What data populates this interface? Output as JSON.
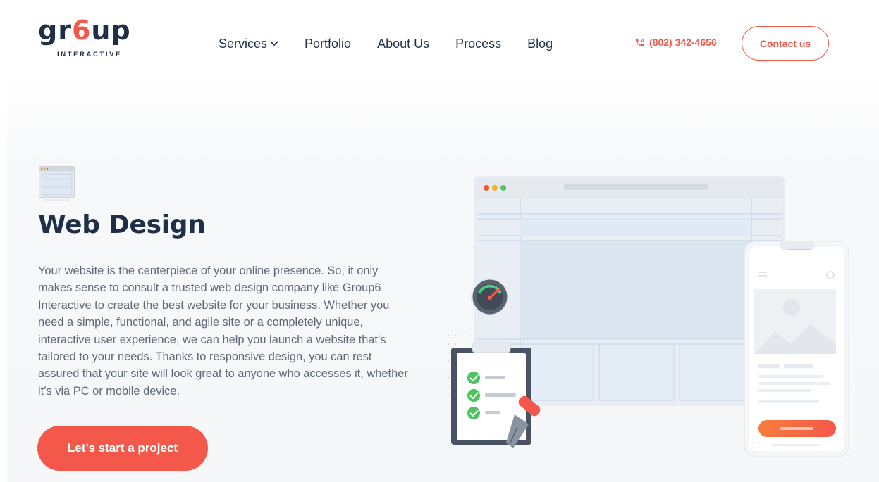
{
  "logo": {
    "word_part1": "gr",
    "word_six": "6",
    "word_part2": "up",
    "subtitle": "INTERACTIVE"
  },
  "nav": {
    "items": [
      {
        "label": "Services"
      },
      {
        "label": "Portfolio"
      },
      {
        "label": "About Us"
      },
      {
        "label": "Process"
      },
      {
        "label": "Blog"
      }
    ]
  },
  "header": {
    "phone": "(802) 342-4656",
    "contact_label": "Contact us"
  },
  "hero": {
    "title": "Web Design",
    "description": "Your website is the centerpiece of your online presence. So, it only makes sense to consult a trusted web design company like Group6 Interactive to create the best website for your business. Whether you need a simple, functional, and agile site or a completely unique, interactive user experience, we can help you launch a website that’s tailored to your needs. Thanks to responsive design, you can rest assured that your site will look great to anyone who accesses it, whether it’s via PC or mobile device.",
    "cta_label": "Let’s start a project"
  },
  "icons": {
    "phone": "phone-icon",
    "chevron": "chevron-down-icon",
    "service": "browser-window-icon"
  },
  "colors": {
    "accent": "#f4584a",
    "navy": "#1f2f47",
    "body_text": "#5f6775",
    "background": "#f6f7f9"
  }
}
